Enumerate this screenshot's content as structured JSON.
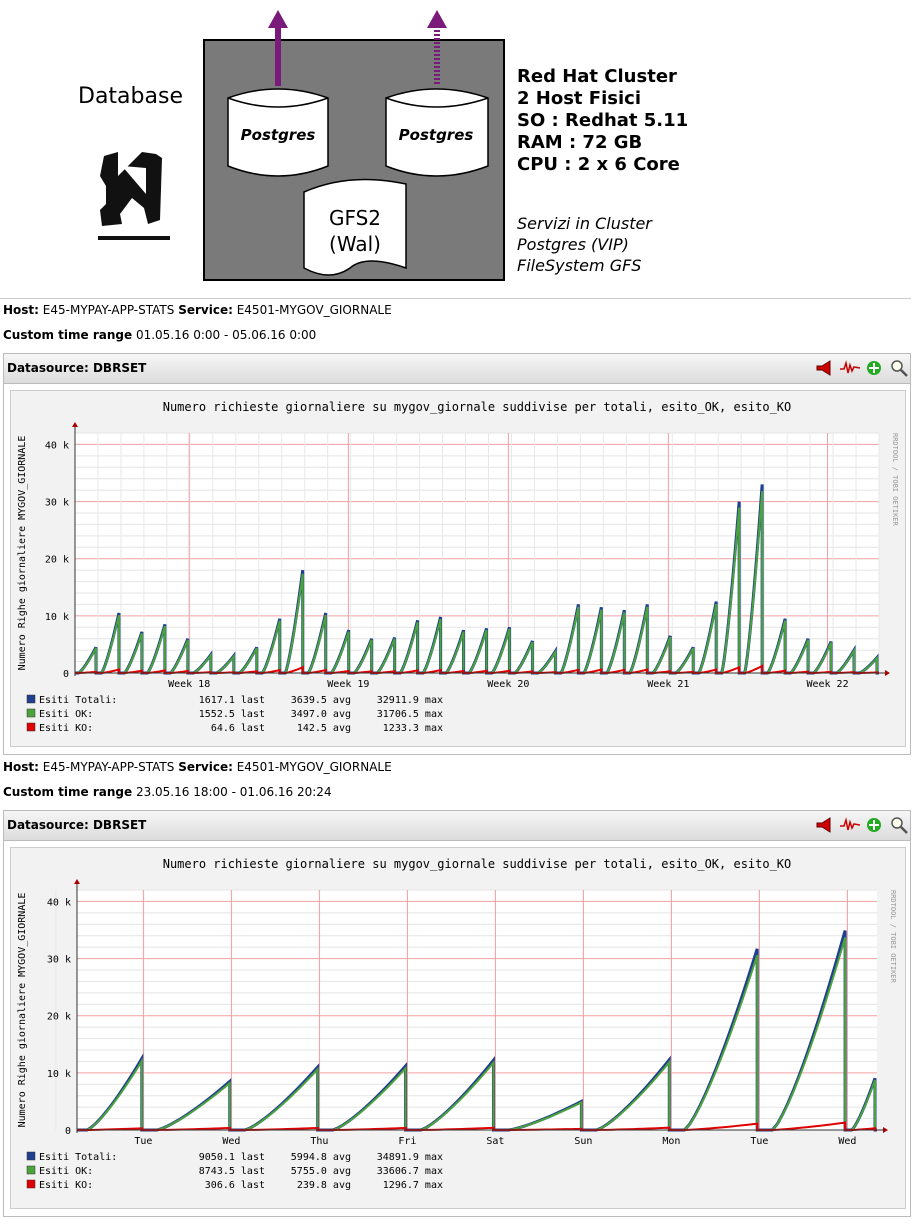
{
  "diagram": {
    "database_label": "Database",
    "postgres_1": "Postgres",
    "postgres_2": "Postgres",
    "gfs_line1": "GFS2",
    "gfs_line2": "(Wal)",
    "cluster_lines": [
      "Red Hat Cluster",
      "2 Host Fisici",
      "SO : Redhat 5.11",
      "RAM : 72 GB",
      "CPU : 2 x 6 Core"
    ],
    "services_lines": [
      "Servizi in Cluster",
      "Postgres (VIP)",
      "FileSystem GFS"
    ]
  },
  "graphs": [
    {
      "host_label": "Host:",
      "host_value": "E45-MYPAY-APP-STATS",
      "service_label": "Service:",
      "service_value": "E4501-MYGOV_GIORNALE",
      "range_label": "Custom time range",
      "range_value": "01.05.16 0:00 - 05.06.16 0:00",
      "datasource": "Datasource: DBRSET",
      "chart_data": {
        "type": "line",
        "title": "Numero richieste giornaliere su mygov_giornale suddivise per totali, esito_OK, esito_KO",
        "ylabel": "Numero Righe giornaliere MYGOV_GIORNALE",
        "side_label": "RRDTOOL / TOBI OETIKER",
        "ylim": [
          0,
          42000
        ],
        "yticks": [
          "0",
          "10 k",
          "20 k",
          "30 k",
          "40 k"
        ],
        "xlabels": [
          "Week 18",
          "Week 19",
          "Week 20",
          "Week 21",
          "Week 22"
        ],
        "x_days": 35,
        "daily_peaks_total": [
          4500,
          10500,
          7200,
          8500,
          6000,
          3200,
          3000,
          4500,
          9500,
          18000,
          10500,
          7500,
          6000,
          6200,
          9200,
          9800,
          7500,
          7800,
          8000,
          5600,
          3800,
          12000,
          11500,
          11000,
          12000,
          6500,
          4500,
          12500,
          30000,
          33000,
          9500,
          6000,
          5500,
          4000,
          2700
        ],
        "daily_peaks_ko": [
          200,
          600,
          400,
          450,
          350,
          150,
          120,
          300,
          500,
          1000,
          500,
          350,
          300,
          300,
          450,
          500,
          350,
          380,
          400,
          280,
          150,
          550,
          600,
          550,
          600,
          300,
          200,
          600,
          1000,
          1233,
          400,
          250,
          200,
          150,
          100
        ],
        "series": [
          {
            "name": "Esiti Totali:",
            "color": "#1f3f8f",
            "last": "1617.1 last",
            "avg": "3639.5 avg",
            "max": "32911.9 max"
          },
          {
            "name": "Esiti OK:",
            "color": "#4ca33b",
            "last": "1552.5 last",
            "avg": "3497.0 avg",
            "max": "31706.5 max"
          },
          {
            "name": "Esiti KO:",
            "color": "#e00000",
            "last": "64.6 last",
            "avg": "142.5 avg",
            "max": "1233.3 max"
          }
        ]
      }
    },
    {
      "host_label": "Host:",
      "host_value": "E45-MYPAY-APP-STATS",
      "service_label": "Service:",
      "service_value": "E4501-MYGOV_GIORNALE",
      "range_label": "Custom time range",
      "range_value": "23.05.16 18:00 - 01.06.16 20:24",
      "datasource": "Datasource: DBRSET",
      "chart_data": {
        "type": "line",
        "title": "Numero richieste giornaliere su mygov_giornale suddivise per totali, esito_OK, esito_KO",
        "ylabel": "Numero Righe giornaliere MYGOV_GIORNALE",
        "side_label": "RRDTOOL / TOBI OETIKER",
        "ylim": [
          0,
          42000
        ],
        "yticks": [
          "0",
          "10 k",
          "20 k",
          "30 k",
          "40 k"
        ],
        "xlabels": [
          "Tue",
          "Wed",
          "Thu",
          "Fri",
          "Sat",
          "Sun",
          "Mon",
          "Tue",
          "Wed"
        ],
        "x_days": 9.1,
        "daily_peaks_total": [
          12500,
          8500,
          11000,
          11200,
          12200,
          5000,
          12300,
          31700,
          34900,
          9050
        ],
        "daily_peaks_ko": [
          300,
          350,
          350,
          350,
          380,
          200,
          400,
          1100,
          1297,
          306
        ],
        "series": [
          {
            "name": "Esiti Totali:",
            "color": "#1f3f8f",
            "last": "9050.1 last",
            "avg": "5994.8 avg",
            "max": "34891.9 max"
          },
          {
            "name": "Esiti OK:",
            "color": "#4ca33b",
            "last": "8743.5 last",
            "avg": "5755.0 avg",
            "max": "33606.7 max"
          },
          {
            "name": "Esiti KO:",
            "color": "#e00000",
            "last": "306.6 last",
            "avg": "239.8 avg",
            "max": "1296.7 max"
          }
        ]
      }
    }
  ]
}
